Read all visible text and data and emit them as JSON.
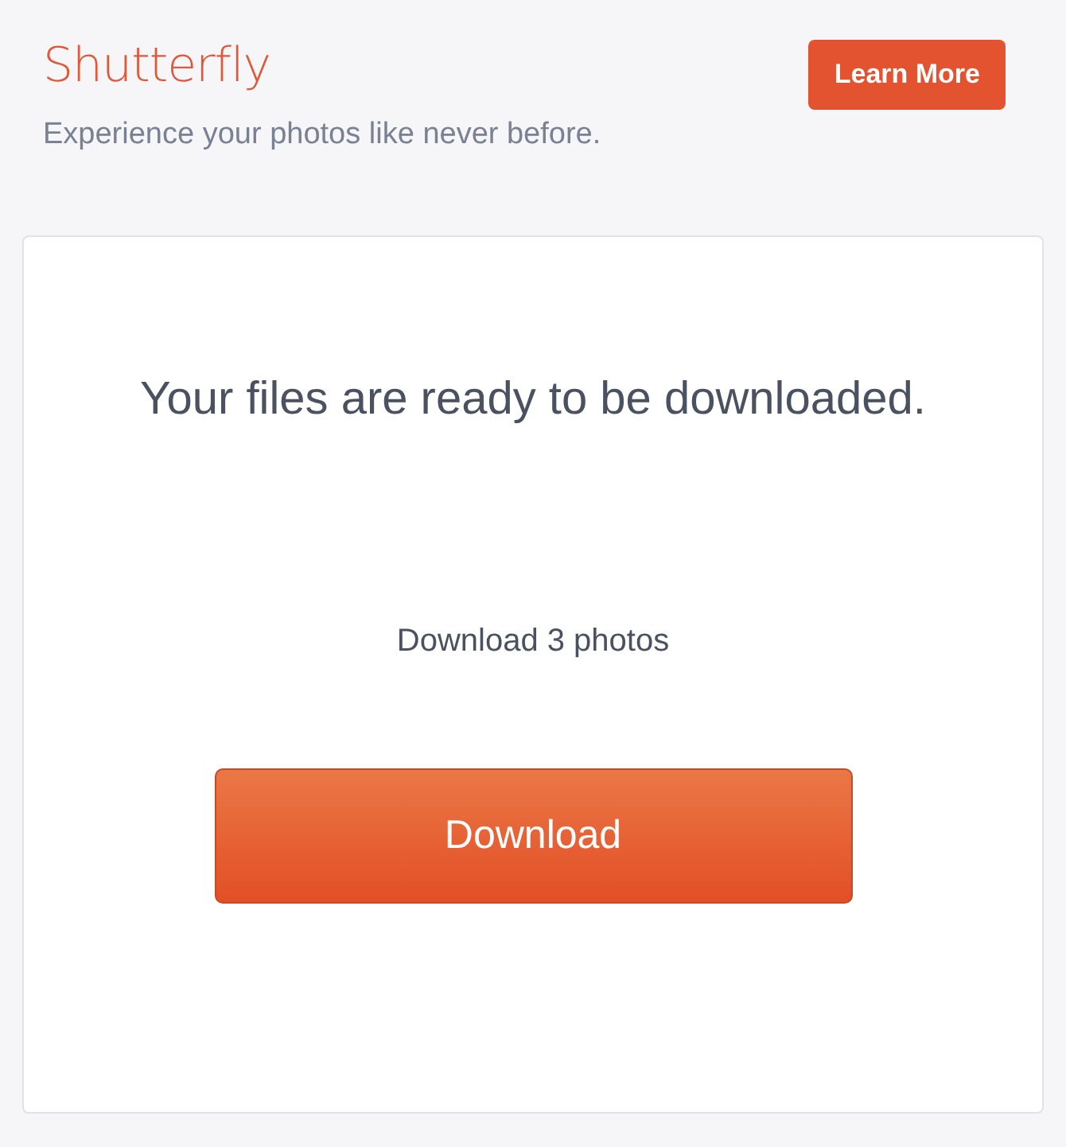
{
  "header": {
    "logo": "Shutterfly",
    "tagline": "Experience your photos like never before.",
    "cta_button": "Learn More"
  },
  "card": {
    "heading": "Your files are ready to be downloaded.",
    "count_text": "Download 3 photos",
    "download_button": "Download"
  }
}
